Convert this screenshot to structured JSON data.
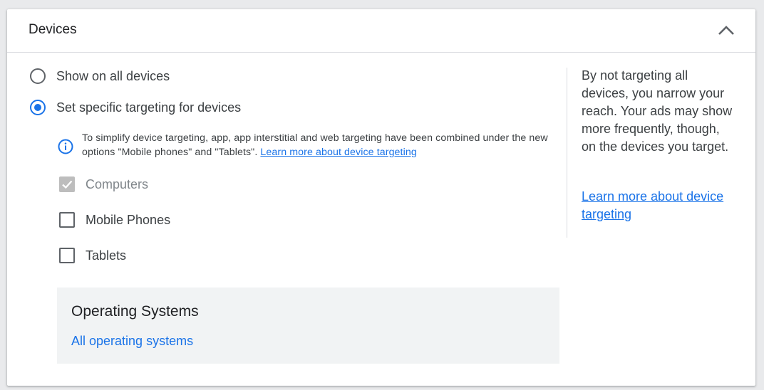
{
  "header": {
    "title": "Devices",
    "collapse_icon": "chevron-up-icon"
  },
  "targeting_options": {
    "all_devices": {
      "label": "Show on all devices",
      "selected": false
    },
    "specific": {
      "label": "Set specific targeting for devices",
      "selected": true
    }
  },
  "info": {
    "icon": "info-icon",
    "text": "To simplify device targeting, app, app interstitial and web targeting have been combined under the new options \"Mobile phones\" and \"Tablets\".",
    "link": "Learn more about device targeting"
  },
  "devices": [
    {
      "label": "Computers",
      "checked": true,
      "disabled": true
    },
    {
      "label": "Mobile Phones",
      "checked": false,
      "disabled": false
    },
    {
      "label": "Tablets",
      "checked": false,
      "disabled": false
    }
  ],
  "operating_systems": {
    "title": "Operating Systems",
    "link": "All operating systems"
  },
  "sidebar": {
    "text": "By not targeting all devices, you narrow your reach. Your ads may show more frequently, though, on the devices you target.",
    "link": "Learn more about device targeting"
  },
  "colors": {
    "accent": "#1a73e8",
    "text": "#3c4043",
    "disabled_check": "#bdbdbd",
    "panel_bg": "#f1f3f4"
  }
}
